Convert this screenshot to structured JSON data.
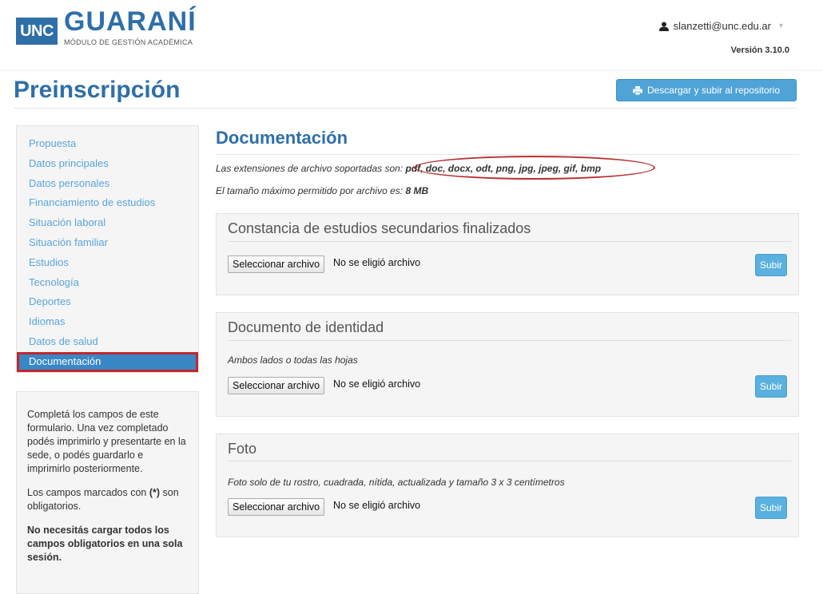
{
  "header": {
    "logo_unc": "UNC",
    "logo_name": "GUARANÍ",
    "logo_subtitle": "MÓDULO DE GESTIÓN ACADÉMICA",
    "user_email": "slanzetti@unc.edu.ar",
    "version": "Versión 3.10.0"
  },
  "page": {
    "title": "Preinscripción",
    "download_button": "Descargar y subir al repositorio"
  },
  "sidebar": {
    "items": [
      {
        "label": "Propuesta"
      },
      {
        "label": "Datos principales"
      },
      {
        "label": "Datos personales"
      },
      {
        "label": "Financiamiento de estudios"
      },
      {
        "label": "Situación laboral"
      },
      {
        "label": "Situación familiar"
      },
      {
        "label": "Estudios"
      },
      {
        "label": "Tecnología"
      },
      {
        "label": "Deportes"
      },
      {
        "label": "Idiomas"
      },
      {
        "label": "Datos de salud"
      },
      {
        "label": "Documentación",
        "active": true
      }
    ]
  },
  "info": {
    "p1": "Completá los campos de este formulario. Una vez completado podés imprimirlo y presentarte en la sede, o podés guardarlo e imprimirlo posteriormente.",
    "p2_pre": "Los campos marcados con ",
    "p2_mark": "(*)",
    "p2_post": " son obligatorios.",
    "p3": "No necesitás cargar todos los campos obligatorios en una sola sesión."
  },
  "content": {
    "title": "Documentación",
    "extensions_label": "Las extensiones de archivo soportadas son: ",
    "extensions": "pdf, doc, docx, odt, png, jpg, jpeg, gif, bmp",
    "max_size_label": "El tamaño máximo permitido por archivo es: ",
    "max_size": "8 MB"
  },
  "panels": [
    {
      "title": "Constancia de estudios secundarios finalizados",
      "description": "",
      "select_button": "Seleccionar archivo",
      "file_status": "No se eligió archivo",
      "upload_button": "Subir"
    },
    {
      "title": "Documento de identidad",
      "description": "Ambos lados o todas las hojas",
      "select_button": "Seleccionar archivo",
      "file_status": "No se eligió archivo",
      "upload_button": "Subir"
    },
    {
      "title": "Foto",
      "description": "Foto solo de tu rostro, cuadrada, nítida, actualizada y tamaño 3 x 3 centímetros",
      "select_button": "Seleccionar archivo",
      "file_status": "No se eligió archivo",
      "upload_button": "Subir"
    }
  ],
  "icons": {
    "user": "user-icon",
    "print": "print-icon",
    "caret": "caret-down-icon"
  },
  "colors": {
    "brand": "#2f6fa8",
    "link": "#5aa5d9",
    "active": "#3a87c5",
    "highlight": "#c0272d",
    "button": "#5ab0de"
  }
}
